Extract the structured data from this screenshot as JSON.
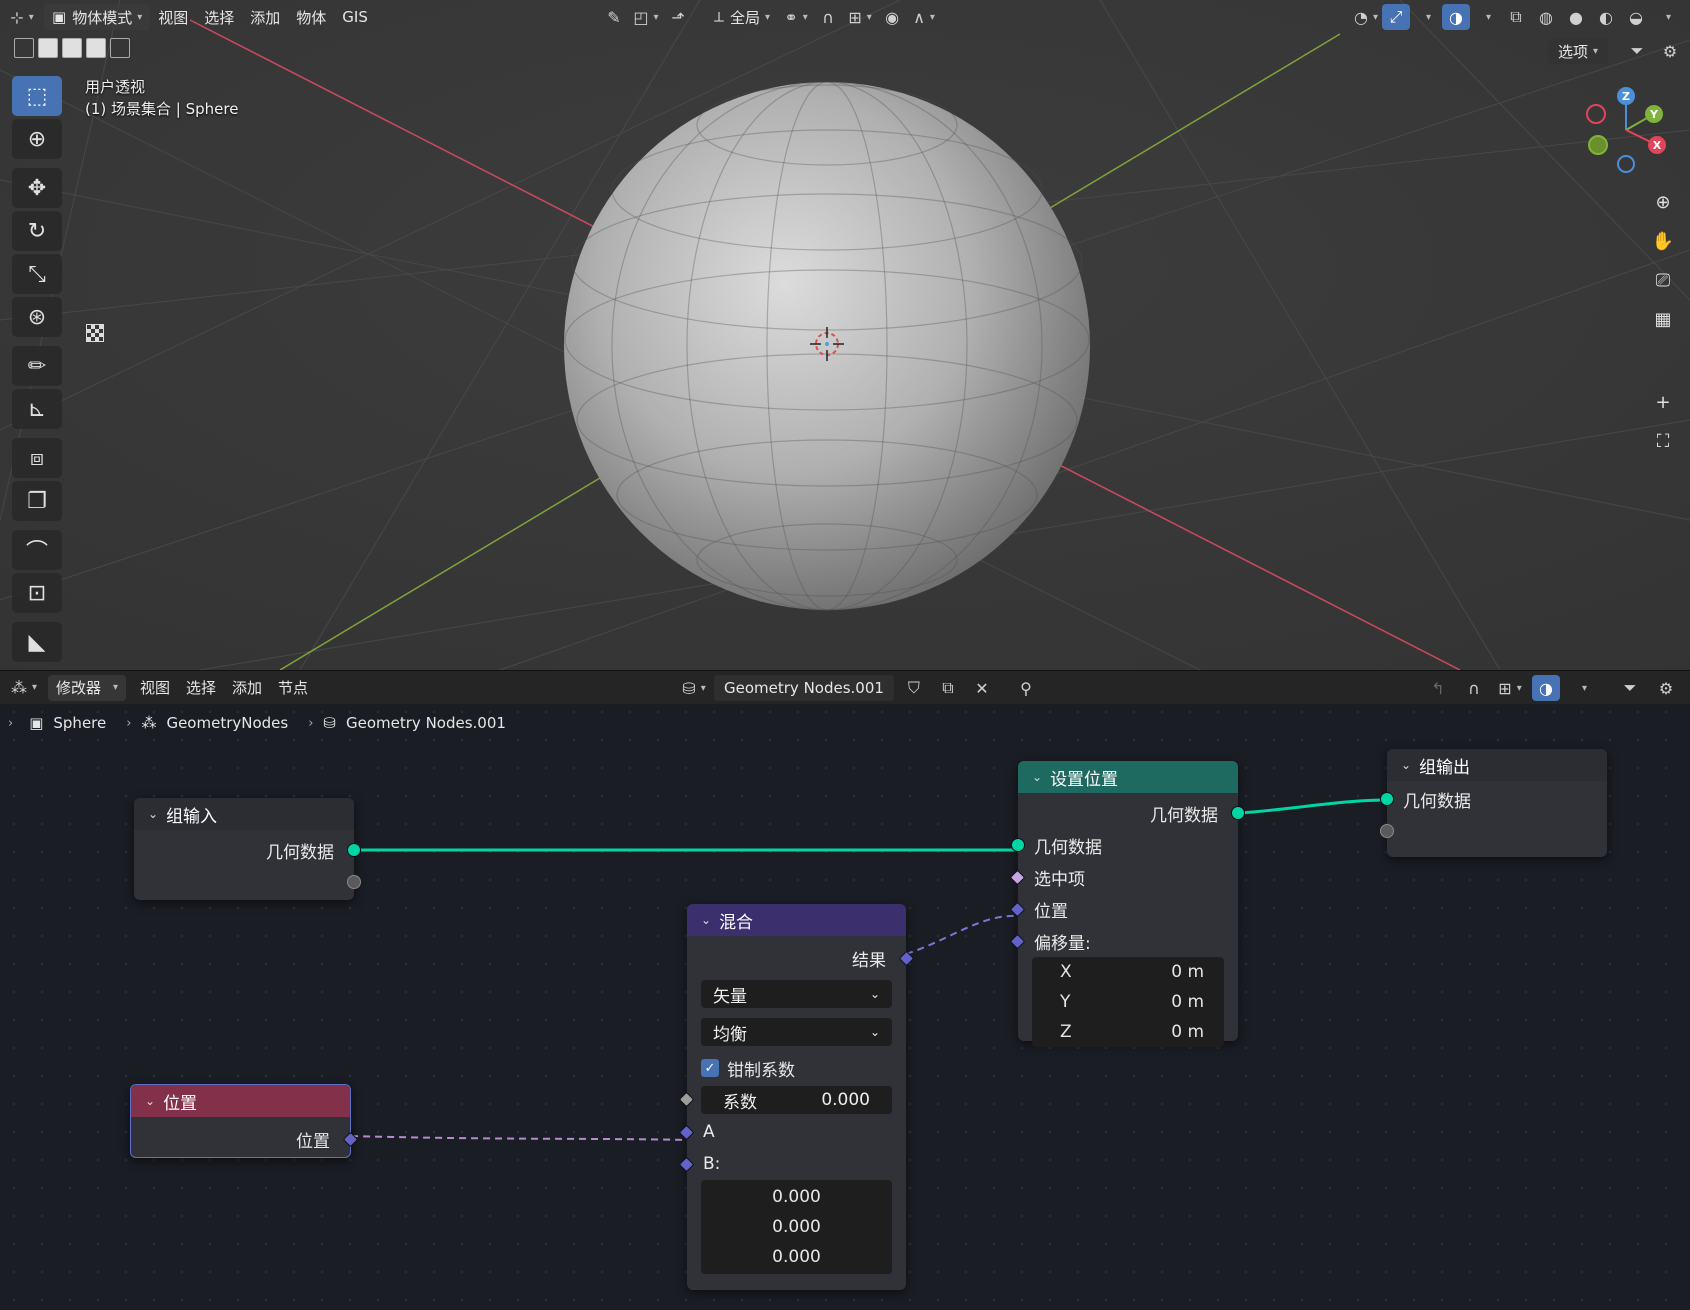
{
  "viewport": {
    "mode_label": "物体模式",
    "menus": [
      "视图",
      "选择",
      "添加",
      "物体",
      "GIS"
    ],
    "transform_orientation": "全局",
    "options_label": "选项",
    "overlay_line1": "用户透视",
    "overlay_line2": "(1) 场景集合 | Sphere",
    "gizmo": {
      "z": "Z",
      "y": "Y",
      "x": "X"
    },
    "tools": [
      "select-box-icon",
      "cursor-icon",
      "move-icon",
      "rotate-icon",
      "scale-icon",
      "transform-icon",
      "annotate-icon",
      "measure-icon",
      "add-cube-icon",
      "add-object-icon",
      "bend-icon",
      "shrink-icon",
      "knife-icon"
    ],
    "colors": {
      "x_axis": "#c94a5e",
      "y_axis": "#7fa33c",
      "accent": "#4772b3"
    }
  },
  "node_editor": {
    "editor_type_label": "修改器",
    "menus": [
      "视图",
      "选择",
      "添加",
      "节点"
    ],
    "node_group_name": "Geometry Nodes.001",
    "breadcrumb": {
      "object": "Sphere",
      "modifier": "GeometryNodes",
      "group": "Geometry Nodes.001"
    },
    "nodes": {
      "group_input": {
        "title": "组输入",
        "out_geometry": "几何数据"
      },
      "position": {
        "title": "位置",
        "out_position": "位置"
      },
      "mix": {
        "title": "混合",
        "out_result": "结果",
        "data_type": "矢量",
        "mode": "均衡",
        "clamp_label": "钳制系数",
        "factor_label": "系数",
        "factor_value": "0.000",
        "in_a": "A",
        "in_b": "B:",
        "b_values": [
          "0.000",
          "0.000",
          "0.000"
        ]
      },
      "set_position": {
        "title": "设置位置",
        "out_geometry": "几何数据",
        "in_geometry": "几何数据",
        "in_selection": "选中项",
        "in_position": "位置",
        "in_offset": "偏移量:",
        "offset": [
          {
            "axis": "X",
            "value": "0 m"
          },
          {
            "axis": "Y",
            "value": "0 m"
          },
          {
            "axis": "Z",
            "value": "0 m"
          }
        ]
      },
      "group_output": {
        "title": "组输出",
        "in_geometry": "几何数据"
      }
    },
    "colors": {
      "geometry_socket": "#00d6a3",
      "vector_socket": "#6363c7",
      "input_header": "#2b2d33",
      "geometry_header": "#1e6a60",
      "utility_header": "#3b2f6e",
      "input_node_header": "#83314a"
    }
  }
}
